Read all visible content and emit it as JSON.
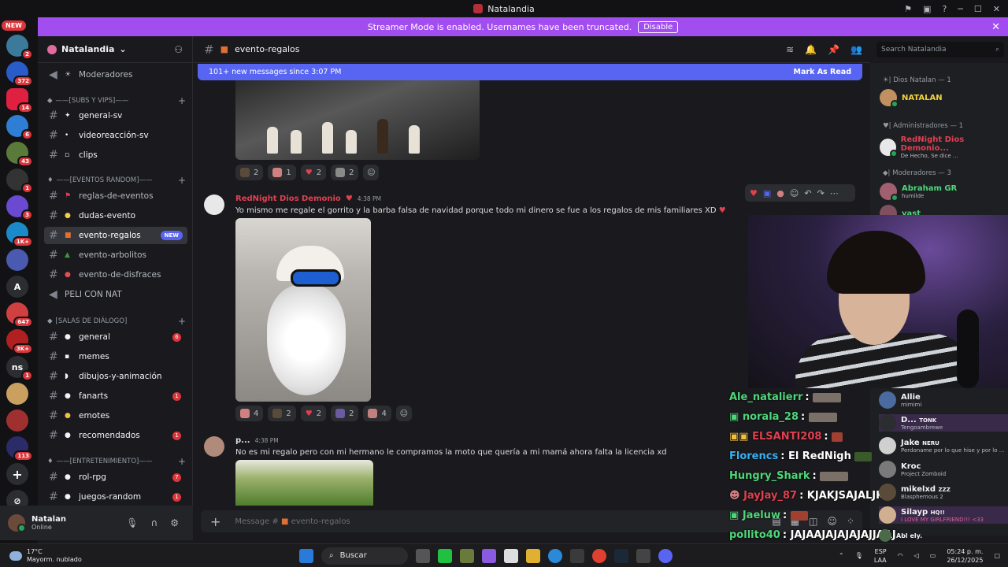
{
  "window": {
    "title": "Natalandia"
  },
  "banner": {
    "text": "Streamer Mode is enabled. Usernames have been truncated.",
    "button": "Disable"
  },
  "servers": {
    "new_label": "NEW",
    "badges": [
      "2",
      "372",
      "14",
      "6",
      "43",
      "1",
      "3",
      "1K+",
      "647",
      "3K+",
      "1",
      "113"
    ],
    "letter_a": "A",
    "letter_ns": "ns"
  },
  "server": {
    "name": "Natalandia"
  },
  "channels": {
    "moderadores": "Moderadores",
    "cat_subs": "——[SUBS Y VIPS]——",
    "general_sv": "general-sv",
    "videoreaccion": "videoreacción-sv",
    "clips": "clips",
    "cat_eventos": "——[EVENTOS RANDOM]——",
    "reglas": "reglas-de-eventos",
    "dudas": "dudas-evento",
    "regalos": "evento-regalos",
    "regalos_badge": "NEW",
    "arbolitos": "evento-arbolitos",
    "disfraces": "evento-de-disfraces",
    "peli": "PELI CON NAT",
    "cat_salas": "[SALAS DE DIÁLOGO]",
    "general": "general",
    "general_count": "6",
    "memes": "memes",
    "dibujos": "dibujos-y-animación",
    "fanarts": "fanarts",
    "fanarts_count": "1",
    "emotes": "emotes",
    "recomendados": "recomendados",
    "recomendados_count": "1",
    "cat_entret": "——[ENTRETENIMIENTO]——",
    "rolrpg": "rol-rpg",
    "rolrpg_count": "7",
    "juegos": "juegos-random",
    "juegos_count": "1"
  },
  "user": {
    "name": "Natalan",
    "status": "Online"
  },
  "header": {
    "channel": "evento-regalos",
    "search_placeholder": "Search Natalandia"
  },
  "newmessages": {
    "text": "101+ new messages since 3:07 PM",
    "action": "Mark As Read"
  },
  "messages": [
    {
      "reactions": [
        "2",
        "1",
        "2",
        "2"
      ]
    },
    {
      "author": "RedNight Dios Demonio",
      "time": "4:38 PM",
      "text": "Yo mismo me regale el gorrito y la barba falsa de navidad porque todo mi dinero se fue a los regalos de mis familiares XD",
      "reactions": [
        "4",
        "2",
        "2",
        "2",
        "4"
      ]
    },
    {
      "author": "p...",
      "time": "4:38 PM",
      "text": "No es mi regalo pero con mi hermano le compramos la moto que quería a mi mamá ahora falta la licencia xd"
    }
  ],
  "composer": {
    "placeholder": "Message #",
    "channel": "evento-regalos"
  },
  "members": {
    "g1": "| Dios Natalan — 1",
    "m1": "NATALAN",
    "g2": "| Administradores — 1",
    "m2": "RedNight Dios Demonio...",
    "m2s": "De Hecho, Se dice ...",
    "g3": "| Moderadores — 3",
    "m3": "Abraham GR",
    "m3s": "humilde",
    "m4": "yast"
  },
  "twitch_chat": [
    {
      "user": "Ale_natalierr",
      "msg": ""
    },
    {
      "user": "norala_28",
      "msg": ""
    },
    {
      "user": "ELSANTI208",
      "msg": ""
    },
    {
      "user": "Florencs",
      "msg": "El RedNigh"
    },
    {
      "user": "Hungry_Shark",
      "msg": ""
    },
    {
      "user": "JayJay_87",
      "msg": "KJAKJSAJALJKA"
    },
    {
      "user": "Jaeluw",
      "msg": ""
    },
    {
      "user": "pollito40",
      "msg": "JAJAAJAJAJAJAJJAAJ"
    }
  ],
  "side_feed": [
    {
      "name": "Allie",
      "sub": "mimimi"
    },
    {
      "name": "D...",
      "tag": "TONK",
      "sub": "Tengoambrewe"
    },
    {
      "name": "Jake",
      "tag": "NERU",
      "sub": "Perdoname por lo que hise y por lo ..."
    },
    {
      "name": "Kroc",
      "sub": "Project Zomboid"
    },
    {
      "name": "mikelxd",
      "tag": "ZZZ",
      "sub": "Blasphemous 2"
    },
    {
      "name": "Silayp",
      "tag": "HQ!!",
      "sub": "I LOVE MY GIRLFRIEND!!! <33"
    },
    {
      "name": "Abl",
      "tag": "ely.",
      "sub": ""
    }
  ],
  "taskbar": {
    "temp": "17°C",
    "weather": "Mayorm. nublado",
    "search": "Buscar",
    "lang1": "ESP",
    "lang2": "LAA",
    "time": "05:24 p. m.",
    "date": "26/12/2025"
  },
  "colors": {
    "accent": "#5865f2",
    "banner": "#a14df0",
    "red_badge": "#da373c",
    "admin": "#e04050",
    "mod": "#4fd67a",
    "owner": "#f0d040"
  }
}
